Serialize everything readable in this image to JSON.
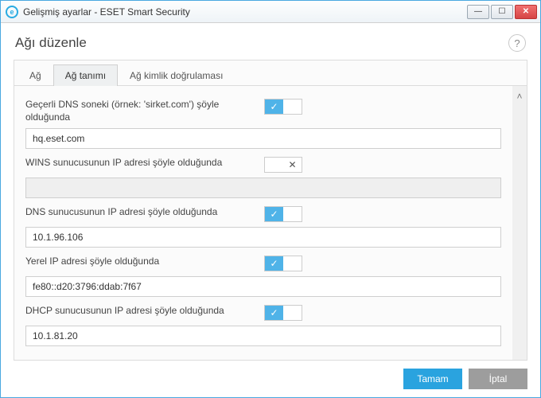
{
  "window": {
    "title": "Gelişmiş ayarlar - ESET Smart Security",
    "app_icon_letter": "e"
  },
  "header": {
    "title": "Ağı düzenle",
    "help": "?"
  },
  "tabs": [
    {
      "label": "Ağ",
      "active": false
    },
    {
      "label": "Ağ tanımı",
      "active": true
    },
    {
      "label": "Ağ kimlik doğrulaması",
      "active": false
    }
  ],
  "fields": {
    "dns_suffix": {
      "label": "Geçerli DNS soneki (örnek: 'sirket.com') şöyle olduğunda",
      "enabled": true,
      "value": "hq.eset.com"
    },
    "wins_ip": {
      "label": "WINS sunucusunun IP adresi şöyle olduğunda",
      "enabled": false,
      "value": ""
    },
    "dns_ip": {
      "label": "DNS sunucusunun IP adresi şöyle olduğunda",
      "enabled": true,
      "value": "10.1.96.106"
    },
    "local_ip": {
      "label": "Yerel IP adresi şöyle olduğunda",
      "enabled": true,
      "value": "fe80::d20:3796:ddab:7f67"
    },
    "dhcp_ip": {
      "label": "DHCP sunucusunun IP adresi şöyle olduğunda",
      "enabled": true,
      "value": "10.1.81.20"
    }
  },
  "buttons": {
    "ok": "Tamam",
    "cancel": "İptal"
  },
  "glyphs": {
    "check": "✓",
    "cross": "✕",
    "chev_up": "˄",
    "min": "—",
    "max": "☐",
    "close": "✕"
  }
}
